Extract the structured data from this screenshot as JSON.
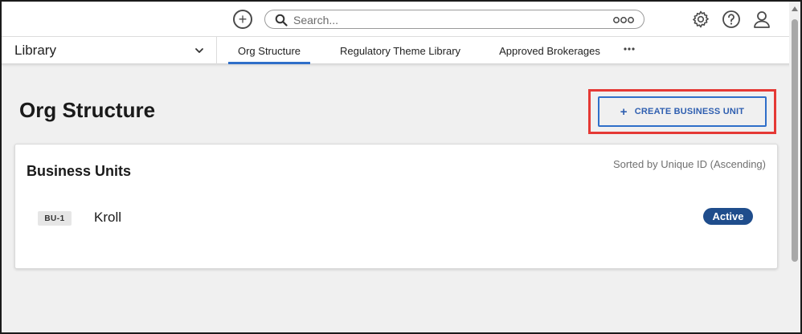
{
  "topbar": {
    "search_placeholder": "Search...",
    "icons": [
      "add-circle-icon",
      "search-icon",
      "more-options-icon",
      "settings-icon",
      "help-icon",
      "user-icon"
    ]
  },
  "navbar": {
    "library_label": "Library",
    "tabs": [
      {
        "label": "Org Structure",
        "active": true
      },
      {
        "label": "Regulatory Theme Library",
        "active": false
      },
      {
        "label": "Approved Brokerages",
        "active": false
      }
    ]
  },
  "page": {
    "title": "Org Structure",
    "create_button_label": "CREATE BUSINESS UNIT"
  },
  "card": {
    "title": "Business Units",
    "sort_text": "Sorted by Unique ID (Ascending)",
    "rows": [
      {
        "code": "BU-1",
        "name": "Kroll",
        "status": "Active"
      }
    ]
  },
  "colors": {
    "accent": "#2f6fc9",
    "highlight": "#e53935",
    "status_active": "#1f4d8c"
  }
}
